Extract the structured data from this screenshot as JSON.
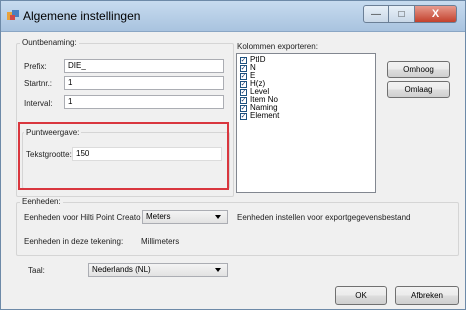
{
  "window": {
    "title": "Algemene instellingen",
    "min_symbol": "—",
    "max_symbol": "□",
    "close_symbol": "X"
  },
  "naming": {
    "title": "Ountbenaming:",
    "prefix_label": "Prefix:",
    "prefix_value": "DIE_",
    "startnr_label": "Startnr.:",
    "startnr_value": "1",
    "interval_label": "Interval:",
    "interval_value": "1"
  },
  "display": {
    "title": "Puntweergave:",
    "textsize_label": "Tekstgrootte:",
    "textsize_value": "150"
  },
  "columns": {
    "title": "Kolommen exporteren:",
    "items": [
      {
        "label": "PtID",
        "checked": true
      },
      {
        "label": "N",
        "checked": true
      },
      {
        "label": "E",
        "checked": true
      },
      {
        "label": "H(z)",
        "checked": true
      },
      {
        "label": "Level",
        "checked": true
      },
      {
        "label": "Item No",
        "checked": true
      },
      {
        "label": "Naming",
        "checked": true
      },
      {
        "label": "Element",
        "checked": true
      }
    ],
    "up_label": "Omhoog",
    "down_label": "Omlaag"
  },
  "units": {
    "title": "Eenheden:",
    "hilti_label": "Eenheden voor Hilti Point Creato",
    "hilti_value": "Meters",
    "export_label": "Eenheden instellen voor exportgegevensbestand",
    "drawing_label": "Eenheden in deze tekening:",
    "drawing_value": "Millimeters"
  },
  "language": {
    "label": "Taal:",
    "value": "Nederlands (NL)"
  },
  "footer": {
    "ok_label": "OK",
    "cancel_label": "Afbreken"
  },
  "colors": {
    "highlight": "#d9363e"
  }
}
